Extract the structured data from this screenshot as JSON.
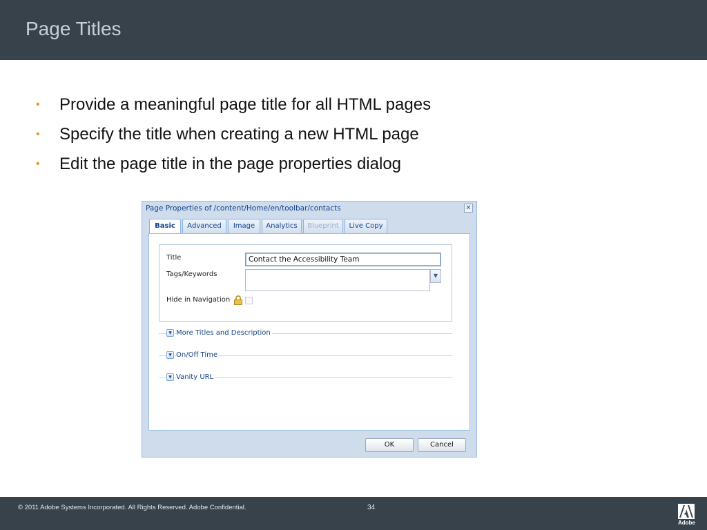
{
  "slide": {
    "title": "Page Titles",
    "bullets": [
      "Provide a meaningful page title for all HTML pages",
      "Specify the title when creating a new HTML page",
      "Edit the page title in the page properties dialog"
    ],
    "bullet_color": "#e8942a"
  },
  "dialog": {
    "title": "Page Properties of /content/Home/en/toolbar/contacts",
    "tabs": [
      {
        "label": "Basic",
        "state": "active"
      },
      {
        "label": "Advanced",
        "state": "normal"
      },
      {
        "label": "Image",
        "state": "normal"
      },
      {
        "label": "Analytics",
        "state": "normal"
      },
      {
        "label": "Blueprint",
        "state": "disabled"
      },
      {
        "label": "Live Copy",
        "state": "normal"
      }
    ],
    "fields": {
      "title_label": "Title",
      "title_value": "Contact the Accessibility Team",
      "tags_label": "Tags/Keywords",
      "tags_value": "",
      "hide_label": "Hide in Navigation",
      "hide_checked": false
    },
    "sections": [
      "More Titles and Description",
      "On/Off Time",
      "Vanity URL"
    ],
    "buttons": {
      "ok": "OK",
      "cancel": "Cancel"
    }
  },
  "footer": {
    "copyright": "© 2011 Adobe Systems Incorporated.  All Rights Reserved.  Adobe Confidential.",
    "page_number": "34",
    "logo_text": "Adobe"
  },
  "colors": {
    "header_bg": "#37424b",
    "title_text": "#c8d0d6",
    "dialog_bg": "#cfdcec"
  }
}
